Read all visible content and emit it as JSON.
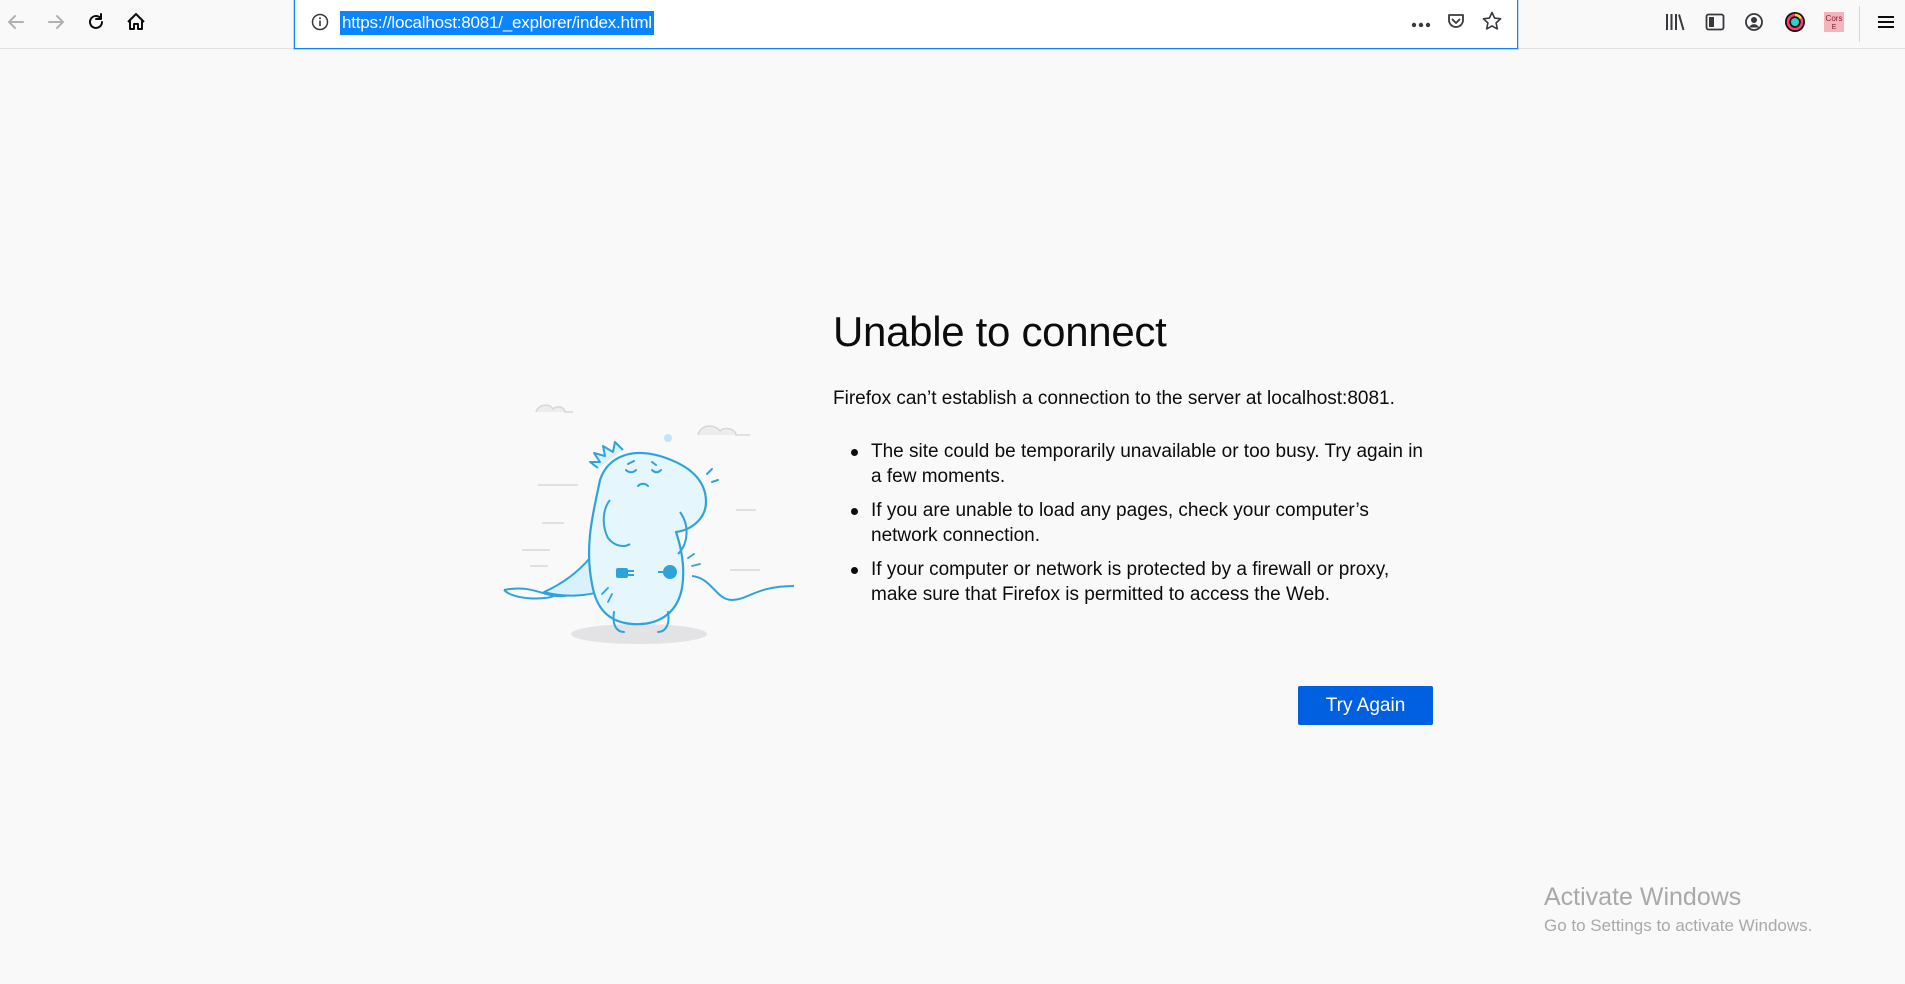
{
  "browser": {
    "url": "https://localhost:8081/_explorer/index.html",
    "extension_badge": "Cors E"
  },
  "error": {
    "title": "Unable to connect",
    "intro": "Firefox can’t establish a connection to the server at localhost:8081.",
    "reasons": [
      "The site could be temporarily unavailable or too busy. Try again in a few moments.",
      "If you are unable to load any pages, check your computer’s network connection.",
      "If your computer or network is protected by a firewall or proxy, make sure that Firefox is permitted to access the Web."
    ],
    "try_again_label": "Try Again"
  },
  "watermark": {
    "title": "Activate Windows",
    "subtitle": "Go to Settings to activate Windows."
  },
  "colors": {
    "accent": "#0a84ff",
    "button": "#0060df",
    "page_bg": "#f9f9fa",
    "illustration": "#2ea3db"
  },
  "icons": {
    "toolbar": [
      "back-arrow-icon",
      "forward-arrow-icon",
      "reload-icon",
      "home-icon"
    ],
    "urlbar": [
      "info-icon",
      "page-actions-icon",
      "pocket-icon",
      "bookmark-star-icon"
    ],
    "right": [
      "library-icon",
      "sidebar-icon",
      "account-icon",
      "extension-icon",
      "cors-extension-icon",
      "menu-icon"
    ]
  }
}
